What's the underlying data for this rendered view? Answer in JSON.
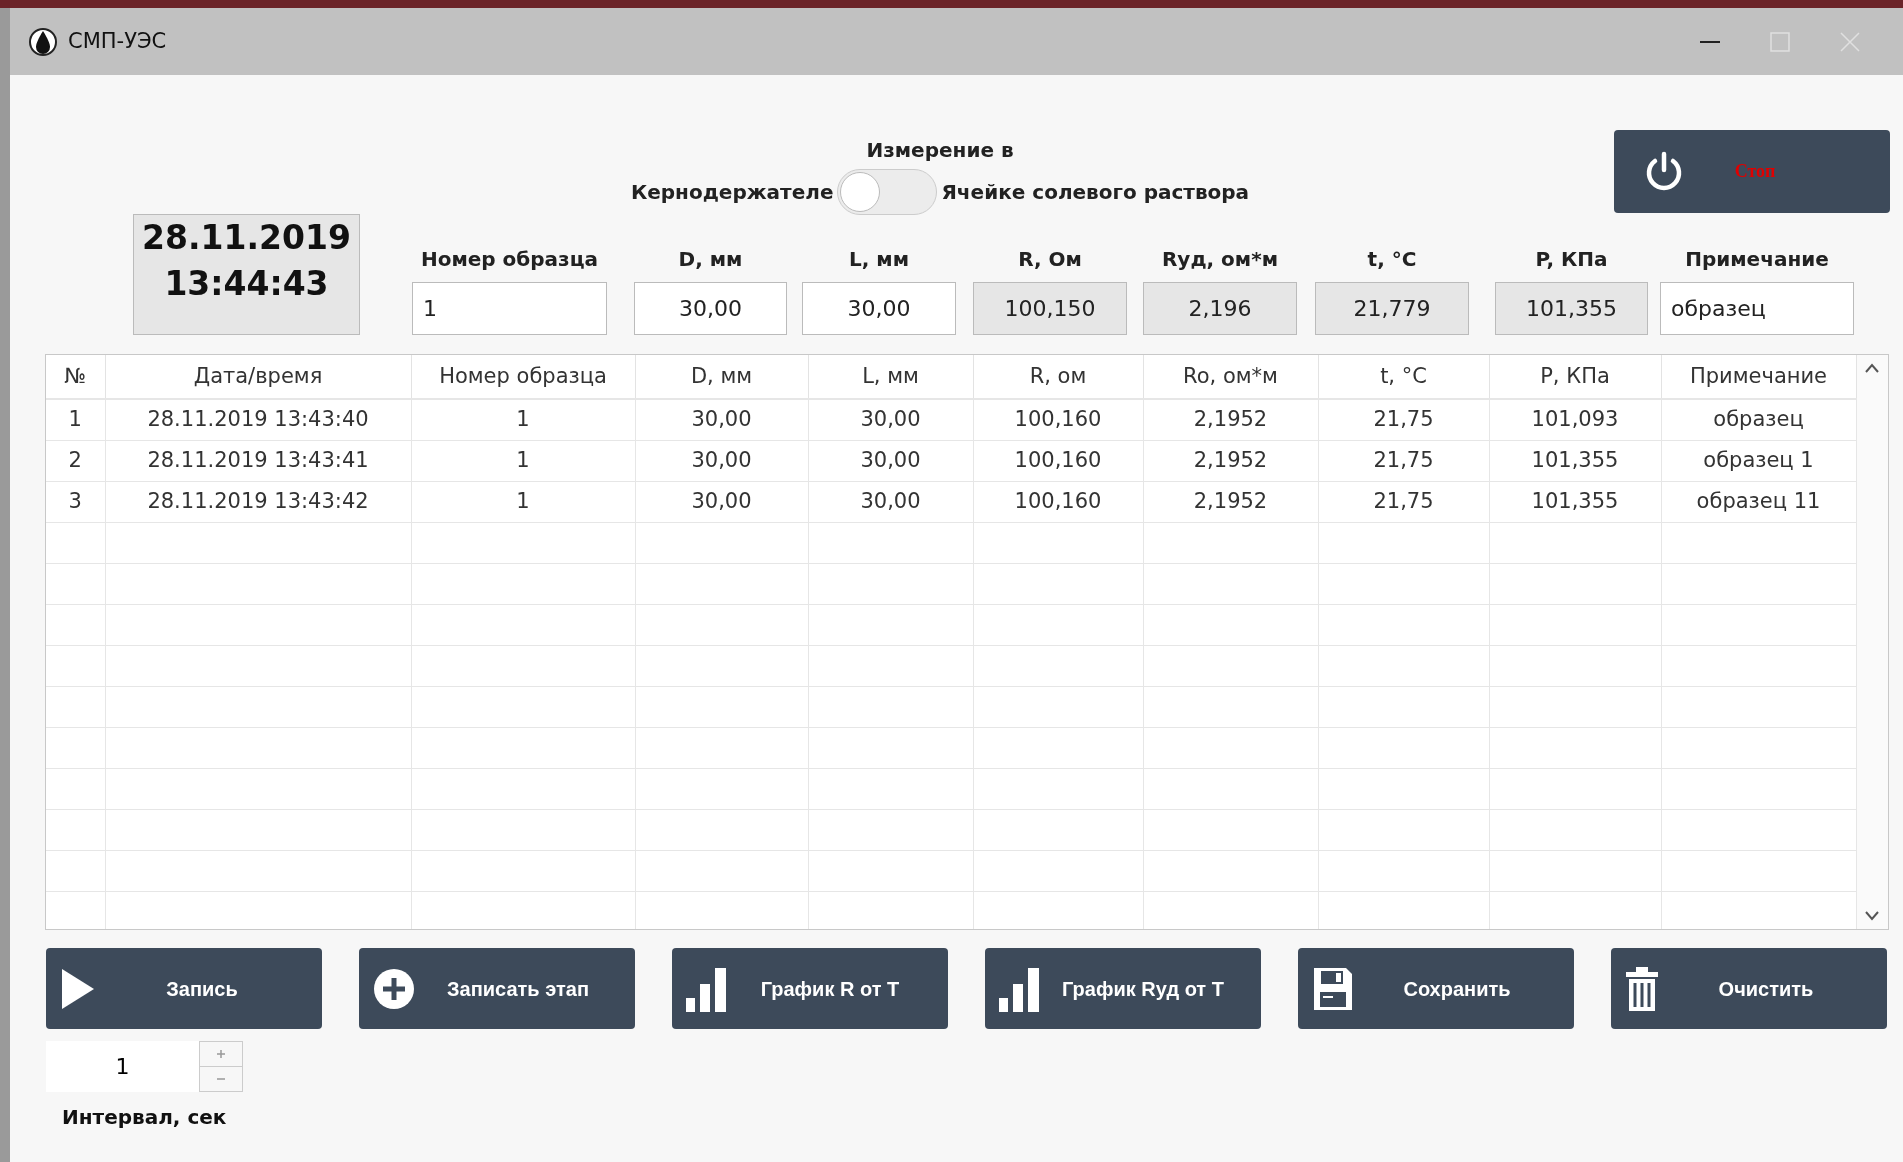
{
  "window": {
    "title": "СМП-УЭС"
  },
  "measurement": {
    "title": "Измерение в",
    "left_label": "Кернодержателе",
    "right_label": "Ячейке солевого раствора",
    "on": false
  },
  "stop_button": {
    "label": "Стоп"
  },
  "clock": {
    "date": "28.11.2019",
    "time": "13:44:43"
  },
  "fields": [
    {
      "label": "Номер образца",
      "value": "1",
      "readonly": false,
      "kind": "text"
    },
    {
      "label": "D, мм",
      "value": "30,00",
      "readonly": false,
      "kind": "number"
    },
    {
      "label": "L, мм",
      "value": "30,00",
      "readonly": false,
      "kind": "number"
    },
    {
      "label": "R, Ом",
      "value": "100,150",
      "readonly": true,
      "kind": "number"
    },
    {
      "label": "Rуд, ом*м",
      "value": "2,196",
      "readonly": true,
      "kind": "number"
    },
    {
      "label": "t, °C",
      "value": "21,779",
      "readonly": true,
      "kind": "number"
    },
    {
      "label": "P, КПа",
      "value": "101,355",
      "readonly": true,
      "kind": "number"
    },
    {
      "label": "Примечание",
      "value": "образец",
      "readonly": false,
      "kind": "text"
    }
  ],
  "table": {
    "columns": [
      "№",
      "Дата/время",
      "Номер образца",
      "D, мм",
      "L, мм",
      "R, ом",
      "Ro, ом*м",
      "t, °C",
      "P, КПа",
      "Примечание"
    ],
    "rows": [
      [
        "1",
        "28.11.2019 13:43:40",
        "1",
        "30,00",
        "30,00",
        "100,160",
        "2,1952",
        "21,75",
        "101,093",
        "образец"
      ],
      [
        "2",
        "28.11.2019 13:43:41",
        "1",
        "30,00",
        "30,00",
        "100,160",
        "2,1952",
        "21,75",
        "101,355",
        "образец 1"
      ],
      [
        "3",
        "28.11.2019 13:43:42",
        "1",
        "30,00",
        "30,00",
        "100,160",
        "2,1952",
        "21,75",
        "101,355",
        "образец 11"
      ]
    ]
  },
  "buttons": [
    {
      "label": "Запись",
      "kind": "play"
    },
    {
      "label": "Записать этап",
      "kind": "add"
    },
    {
      "label": "График R от T",
      "kind": "chart"
    },
    {
      "label": "График Rуд от T",
      "kind": "chart"
    },
    {
      "label": "Сохранить",
      "kind": "save"
    },
    {
      "label": "Очистить",
      "kind": "trash"
    }
  ],
  "interval": {
    "value": "1",
    "label": "Интервал, сек"
  }
}
